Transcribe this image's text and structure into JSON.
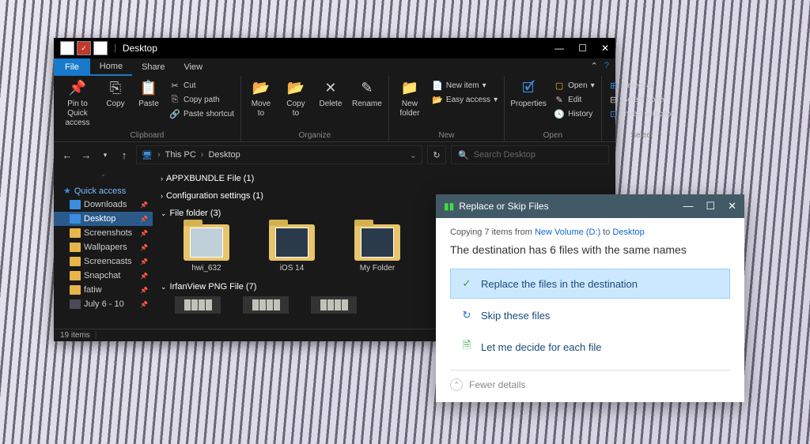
{
  "explorer": {
    "title": "Desktop",
    "tabs": {
      "file": "File",
      "home": "Home",
      "share": "Share",
      "view": "View"
    },
    "ribbon": {
      "clipboard": {
        "label": "Clipboard",
        "pin": "Pin to Quick access",
        "copy": "Copy",
        "paste": "Paste",
        "cut": "Cut",
        "copy_path": "Copy path",
        "paste_shortcut": "Paste shortcut"
      },
      "organize": {
        "label": "Organize",
        "move_to": "Move to",
        "copy_to": "Copy to",
        "delete": "Delete",
        "rename": "Rename"
      },
      "new": {
        "label": "New",
        "new_folder": "New folder",
        "new_item": "New item",
        "easy_access": "Easy access"
      },
      "open": {
        "label": "Open",
        "properties": "Properties",
        "open": "Open",
        "edit": "Edit",
        "history": "History"
      },
      "select": {
        "label": "Select",
        "select_all": "Select all",
        "select_none": "Select none",
        "invert": "Invert selection"
      }
    },
    "breadcrumb": {
      "seg1": "This PC",
      "seg2": "Desktop"
    },
    "search_placeholder": "Search Desktop",
    "sidebar": {
      "quick_access": "Quick access",
      "items": [
        {
          "label": "Downloads"
        },
        {
          "label": "Desktop"
        },
        {
          "label": "Screenshots"
        },
        {
          "label": "Wallpapers"
        },
        {
          "label": "Screencasts"
        },
        {
          "label": "Snapchat"
        },
        {
          "label": "fatiw"
        },
        {
          "label": "July 6 - 10"
        }
      ]
    },
    "groups": [
      {
        "title": "APPXBUNDLE File (1)"
      },
      {
        "title": "Configuration settings (1)"
      },
      {
        "title": "File folder (3)",
        "folders": [
          {
            "label": "hwi_632"
          },
          {
            "label": "iOS 14"
          },
          {
            "label": "My Folder"
          }
        ]
      },
      {
        "title": "IrfanView PNG File (7)"
      }
    ],
    "status": "19 items"
  },
  "dialog": {
    "title": "Replace or Skip Files",
    "copy_line_prefix": "Copying 7 items from ",
    "copy_from": "New Volume (D:)",
    "copy_to_word": " to ",
    "copy_to": "Desktop",
    "message": "The destination has 6 files with the same names",
    "opt_replace": "Replace the files in the destination",
    "opt_skip": "Skip these files",
    "opt_decide": "Let me decide for each file",
    "fewer": "Fewer details"
  }
}
